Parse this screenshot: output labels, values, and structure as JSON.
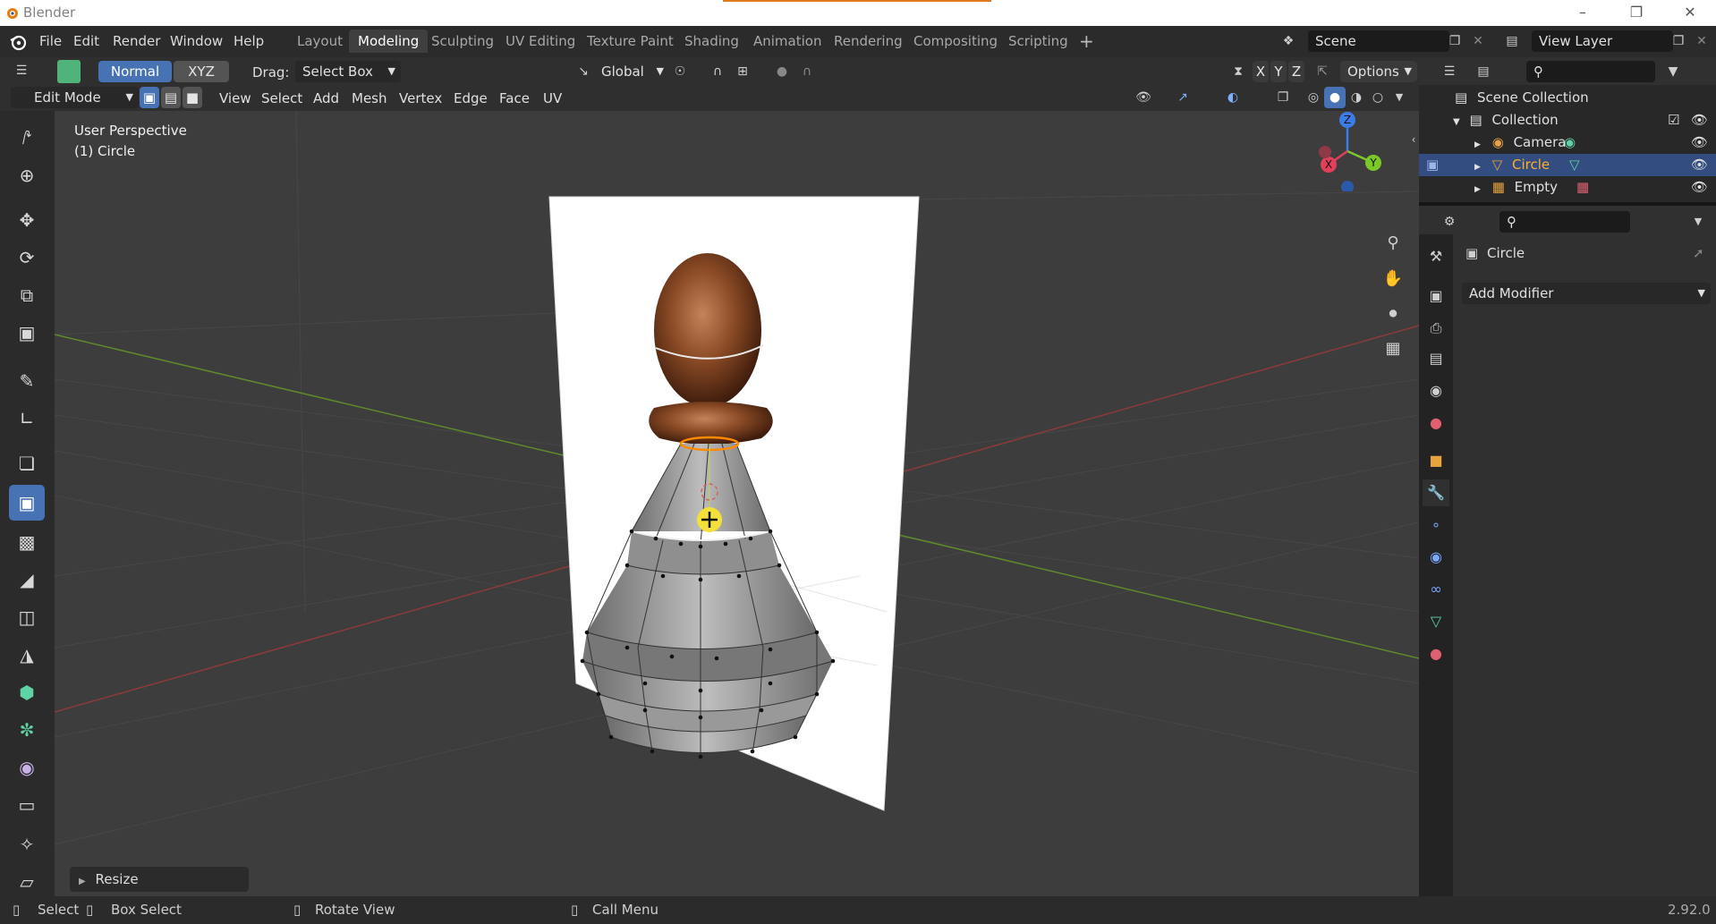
{
  "window": {
    "title": "Blender"
  },
  "menu": [
    "File",
    "Edit",
    "Render",
    "Window",
    "Help"
  ],
  "workspaces": [
    {
      "label": "Layout",
      "active": false
    },
    {
      "label": "Modeling",
      "active": true
    },
    {
      "label": "Sculpting",
      "active": false
    },
    {
      "label": "UV Editing",
      "active": false
    },
    {
      "label": "Texture Paint",
      "active": false
    },
    {
      "label": "Shading",
      "active": false
    },
    {
      "label": "Animation",
      "active": false
    },
    {
      "label": "Rendering",
      "active": false
    },
    {
      "label": "Compositing",
      "active": false
    },
    {
      "label": "Scripting",
      "active": false
    }
  ],
  "scene": {
    "name": "Scene"
  },
  "view_layer": {
    "name": "View Layer"
  },
  "tool_settings": {
    "normal_label": "Normal",
    "xyz_label": "XYZ",
    "drag_label": "Drag:",
    "drag_value": "Select Box",
    "orientation": "Global",
    "options_label": "Options",
    "axes": [
      "X",
      "Y",
      "Z"
    ]
  },
  "editor_header": {
    "mode": "Edit Mode",
    "menus": [
      "View",
      "Select",
      "Add",
      "Mesh",
      "Vertex",
      "Edge",
      "Face",
      "UV"
    ]
  },
  "viewport": {
    "perspective": "User Perspective",
    "object": "(1) Circle",
    "last_operator": "Resize",
    "gizmo_axes": [
      "Z",
      "Y",
      "X"
    ]
  },
  "outliner": {
    "root": "Scene Collection",
    "collection": "Collection",
    "items": [
      {
        "label": "Camera",
        "selected": false
      },
      {
        "label": "Circle",
        "selected": true
      },
      {
        "label": "Empty",
        "selected": false
      }
    ]
  },
  "properties": {
    "object_name": "Circle",
    "add_modifier": "Add Modifier"
  },
  "statusbar": {
    "select": "Select",
    "box_select": "Box Select",
    "rotate_view": "Rotate View",
    "call_menu": "Call Menu",
    "version": "2.92.0"
  },
  "colors": {
    "accent": "#4772b3",
    "selection": "#334d80",
    "active_text": "#ffaf29",
    "background": "#3d3d3d"
  }
}
